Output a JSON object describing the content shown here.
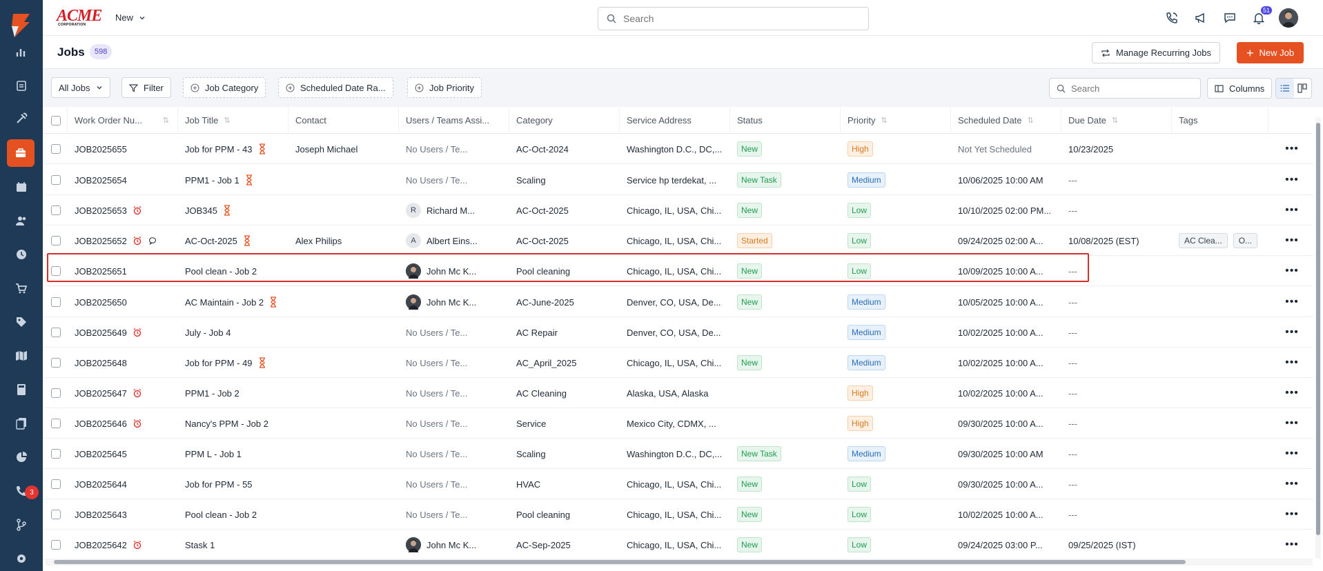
{
  "app": {
    "brand": "ACME",
    "brand_sub": "CORPORATION",
    "new_menu_label": "New"
  },
  "topbar": {
    "search_placeholder": "Search",
    "notification_count": "51"
  },
  "sidebar": {
    "items": [
      {
        "icon": "bar-chart-icon"
      },
      {
        "icon": "clipboard-icon"
      },
      {
        "icon": "tools-icon"
      },
      {
        "icon": "briefcase-icon",
        "active": true
      },
      {
        "icon": "calendar-icon"
      },
      {
        "icon": "users-icon"
      },
      {
        "icon": "clock-icon"
      },
      {
        "icon": "cart-icon"
      },
      {
        "icon": "tag-icon"
      },
      {
        "icon": "map-icon"
      },
      {
        "icon": "calculator-icon"
      },
      {
        "icon": "documents-icon"
      },
      {
        "icon": "pie-chart-icon"
      },
      {
        "icon": "phone-support-icon",
        "badge": "3"
      },
      {
        "icon": "branch-icon"
      },
      {
        "icon": "settings-icon"
      }
    ],
    "badge": "3"
  },
  "header": {
    "title": "Jobs",
    "count": "598",
    "manage_label": "Manage Recurring Jobs",
    "new_job_label": "New Job"
  },
  "filters": {
    "view_label": "All Jobs",
    "filter_label": "Filter",
    "job_category_label": "Job Category",
    "scheduled_date_label": "Scheduled Date Ra...",
    "job_priority_label": "Job Priority",
    "search_placeholder": "Search",
    "columns_label": "Columns"
  },
  "table": {
    "columns": [
      "Work Order Nu...",
      "Job Title",
      "Contact",
      "Users / Teams Assi...",
      "Category",
      "Service Address",
      "Status",
      "Priority",
      "Scheduled Date",
      "Due Date",
      "Tags"
    ],
    "rows": [
      {
        "wo": "JOB2025655",
        "alarm": false,
        "chat": false,
        "title": "Job for PPM - 43",
        "hourglass": true,
        "contact": "Joseph Michael",
        "user": "No Users / Te...",
        "avatar": "",
        "category": "AC-Oct-2024",
        "address": "Washington D.C., DC,...",
        "status": "New",
        "priority": "High",
        "scheduled": "Not Yet Scheduled",
        "due": "10/23/2025",
        "tags": []
      },
      {
        "wo": "JOB2025654",
        "alarm": false,
        "chat": false,
        "title": "PPM1 - Job 1",
        "hourglass": true,
        "contact": "",
        "user": "No Users / Te...",
        "avatar": "",
        "category": "Scaling",
        "address": "Service hp terdekat, ...",
        "status": "New Task",
        "priority": "Medium",
        "scheduled": "10/06/2025 10:00 AM",
        "due": "---",
        "tags": []
      },
      {
        "wo": "JOB2025653",
        "alarm": true,
        "chat": false,
        "title": "JOB345",
        "hourglass": true,
        "contact": "",
        "user": "Richard M...",
        "avatar": "R",
        "category": "AC-Oct-2025",
        "address": "Chicago, IL, USA, Chi...",
        "status": "New",
        "priority": "Low",
        "scheduled": "10/10/2025 02:00 PM...",
        "due": "---",
        "tags": []
      },
      {
        "wo": "JOB2025652",
        "alarm": true,
        "chat": true,
        "title": "AC-Oct-2025",
        "hourglass": true,
        "contact": "Alex Philips",
        "user": "Albert Eins...",
        "avatar": "A",
        "category": "AC-Oct-2025",
        "address": "Chicago, IL, USA, Chi...",
        "status": "Started",
        "priority": "Low",
        "scheduled": "09/24/2025 02:00 A...",
        "due": "10/08/2025 (EST)",
        "tags": [
          "AC Clea...",
          "O..."
        ]
      },
      {
        "wo": "JOB2025651",
        "alarm": false,
        "chat": false,
        "title": "Pool clean - Job 2",
        "hourglass": false,
        "contact": "",
        "user": "John Mc K...",
        "avatar": "photo",
        "category": "Pool cleaning",
        "address": "Chicago, IL, USA, Chi...",
        "status": "New",
        "priority": "Low",
        "scheduled": "10/09/2025 10:00 A...",
        "due": "---",
        "tags": []
      },
      {
        "wo": "JOB2025650",
        "alarm": false,
        "chat": false,
        "title": "AC Maintain - Job 2",
        "hourglass": true,
        "contact": "",
        "user": "John Mc K...",
        "avatar": "photo",
        "category": "AC-June-2025",
        "address": "Denver, CO, USA, De...",
        "status": "New",
        "priority": "Medium",
        "scheduled": "10/05/2025 10:00 A...",
        "due": "---",
        "tags": []
      },
      {
        "wo": "JOB2025649",
        "alarm": true,
        "chat": false,
        "title": "July - Job 4",
        "hourglass": false,
        "contact": "",
        "user": "No Users / Te...",
        "avatar": "",
        "category": "AC Repair",
        "address": "Denver, CO, USA, De...",
        "status": "",
        "priority": "Medium",
        "scheduled": "10/02/2025 10:00 A...",
        "due": "---",
        "tags": []
      },
      {
        "wo": "JOB2025648",
        "alarm": false,
        "chat": false,
        "title": "Job for PPM - 49",
        "hourglass": true,
        "contact": "",
        "user": "No Users / Te...",
        "avatar": "",
        "category": "AC_April_2025",
        "address": "Chicago, IL, USA, Chi...",
        "status": "New",
        "priority": "Medium",
        "scheduled": "10/02/2025 10:00 A...",
        "due": "---",
        "tags": []
      },
      {
        "wo": "JOB2025647",
        "alarm": true,
        "chat": false,
        "title": "PPM1 - Job 2",
        "hourglass": false,
        "contact": "",
        "user": "No Users / Te...",
        "avatar": "",
        "category": "AC Cleaning",
        "address": "Alaska, USA, Alaska",
        "status": "",
        "priority": "High",
        "scheduled": "10/02/2025 10:00 A...",
        "due": "---",
        "tags": []
      },
      {
        "wo": "JOB2025646",
        "alarm": true,
        "chat": false,
        "title": "Nancy's PPM - Job 2",
        "hourglass": false,
        "contact": "",
        "user": "No Users / Te...",
        "avatar": "",
        "category": "Service",
        "address": "Mexico City, CDMX, ...",
        "status": "",
        "priority": "High",
        "scheduled": "09/30/2025 10:00 A...",
        "due": "---",
        "tags": []
      },
      {
        "wo": "JOB2025645",
        "alarm": false,
        "chat": false,
        "title": "PPM L - Job 1",
        "hourglass": false,
        "contact": "",
        "user": "No Users / Te...",
        "avatar": "",
        "category": "Scaling",
        "address": "Washington D.C., DC,...",
        "status": "New Task",
        "priority": "Medium",
        "scheduled": "09/30/2025 10:00 AM",
        "due": "---",
        "tags": []
      },
      {
        "wo": "JOB2025644",
        "alarm": false,
        "chat": false,
        "title": "Job for PPM - 55",
        "hourglass": false,
        "contact": "",
        "user": "No Users / Te...",
        "avatar": "",
        "category": "HVAC",
        "address": "Chicago, IL, USA, Chi...",
        "status": "New",
        "priority": "Low",
        "scheduled": "09/30/2025 10:00 A...",
        "due": "---",
        "tags": []
      },
      {
        "wo": "JOB2025643",
        "alarm": false,
        "chat": false,
        "title": "Pool clean - Job 2",
        "hourglass": false,
        "contact": "",
        "user": "No Users / Te...",
        "avatar": "",
        "category": "Pool cleaning",
        "address": "Chicago, IL, USA, Chi...",
        "status": "New",
        "priority": "Low",
        "scheduled": "10/02/2025 10:00 A...",
        "due": "---",
        "tags": []
      },
      {
        "wo": "JOB2025642",
        "alarm": true,
        "chat": false,
        "title": "Stask 1",
        "hourglass": false,
        "contact": "",
        "user": "John Mc K...",
        "avatar": "photo",
        "category": "AC-Sep-2025",
        "address": "Chicago, IL, USA, Chi...",
        "status": "New",
        "priority": "Low",
        "scheduled": "09/24/2025 03:00 P...",
        "due": "09/25/2025 (IST)",
        "tags": []
      }
    ]
  },
  "colors": {
    "accent": "#e65121",
    "rail": "#1f3a56",
    "highlight": "#d32f2f"
  }
}
